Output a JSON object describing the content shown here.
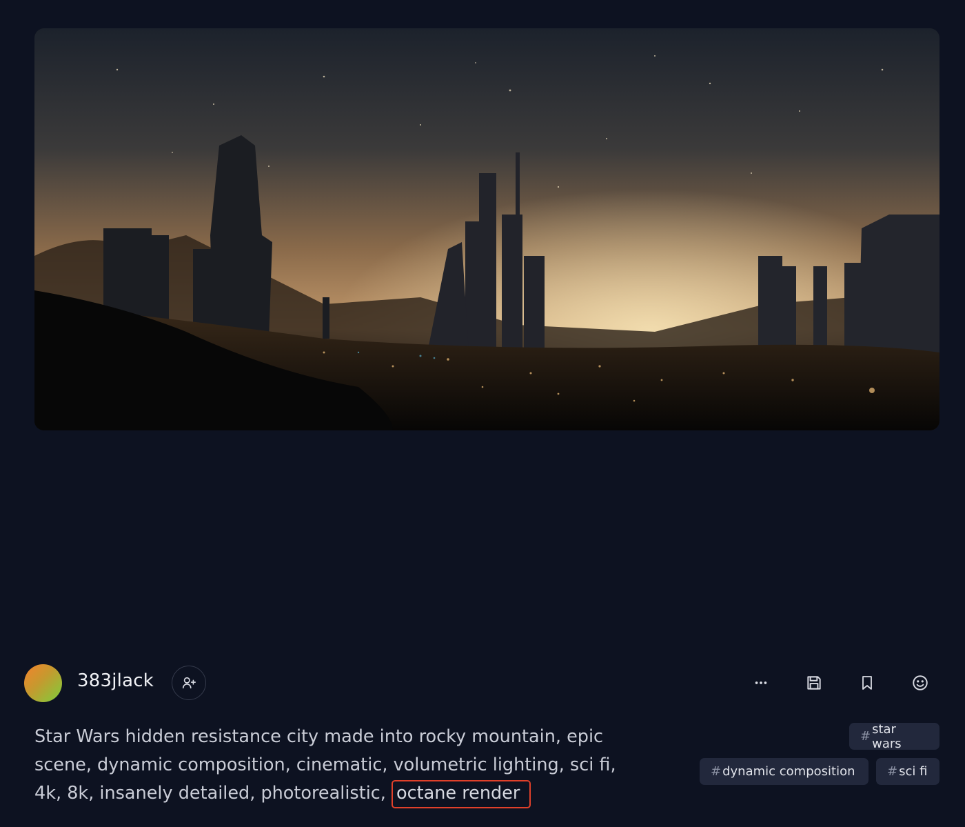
{
  "post": {
    "username": "383jlack",
    "prompt_main": "Star Wars hidden resistance city made into rocky mountain, epic scene, dynamic composition, cinematic, volumetric lighting, sci fi, 4k, 8k, insanely detailed, photorealistic,",
    "prompt_highlight": "octane render",
    "tags": [
      {
        "hash": "#",
        "label": "star wars"
      },
      {
        "hash": "#",
        "label": "dynamic composition"
      },
      {
        "hash": "#",
        "label": "sci fi"
      }
    ]
  },
  "icons": {
    "follow": "user-plus-icon",
    "more": "ellipsis-icon",
    "save": "floppy-disk-icon",
    "bookmark": "bookmark-icon",
    "react": "smiley-icon"
  },
  "colors": {
    "background": "#0d1221",
    "tag_bg": "#22283c",
    "highlight_border": "#e0402a"
  }
}
